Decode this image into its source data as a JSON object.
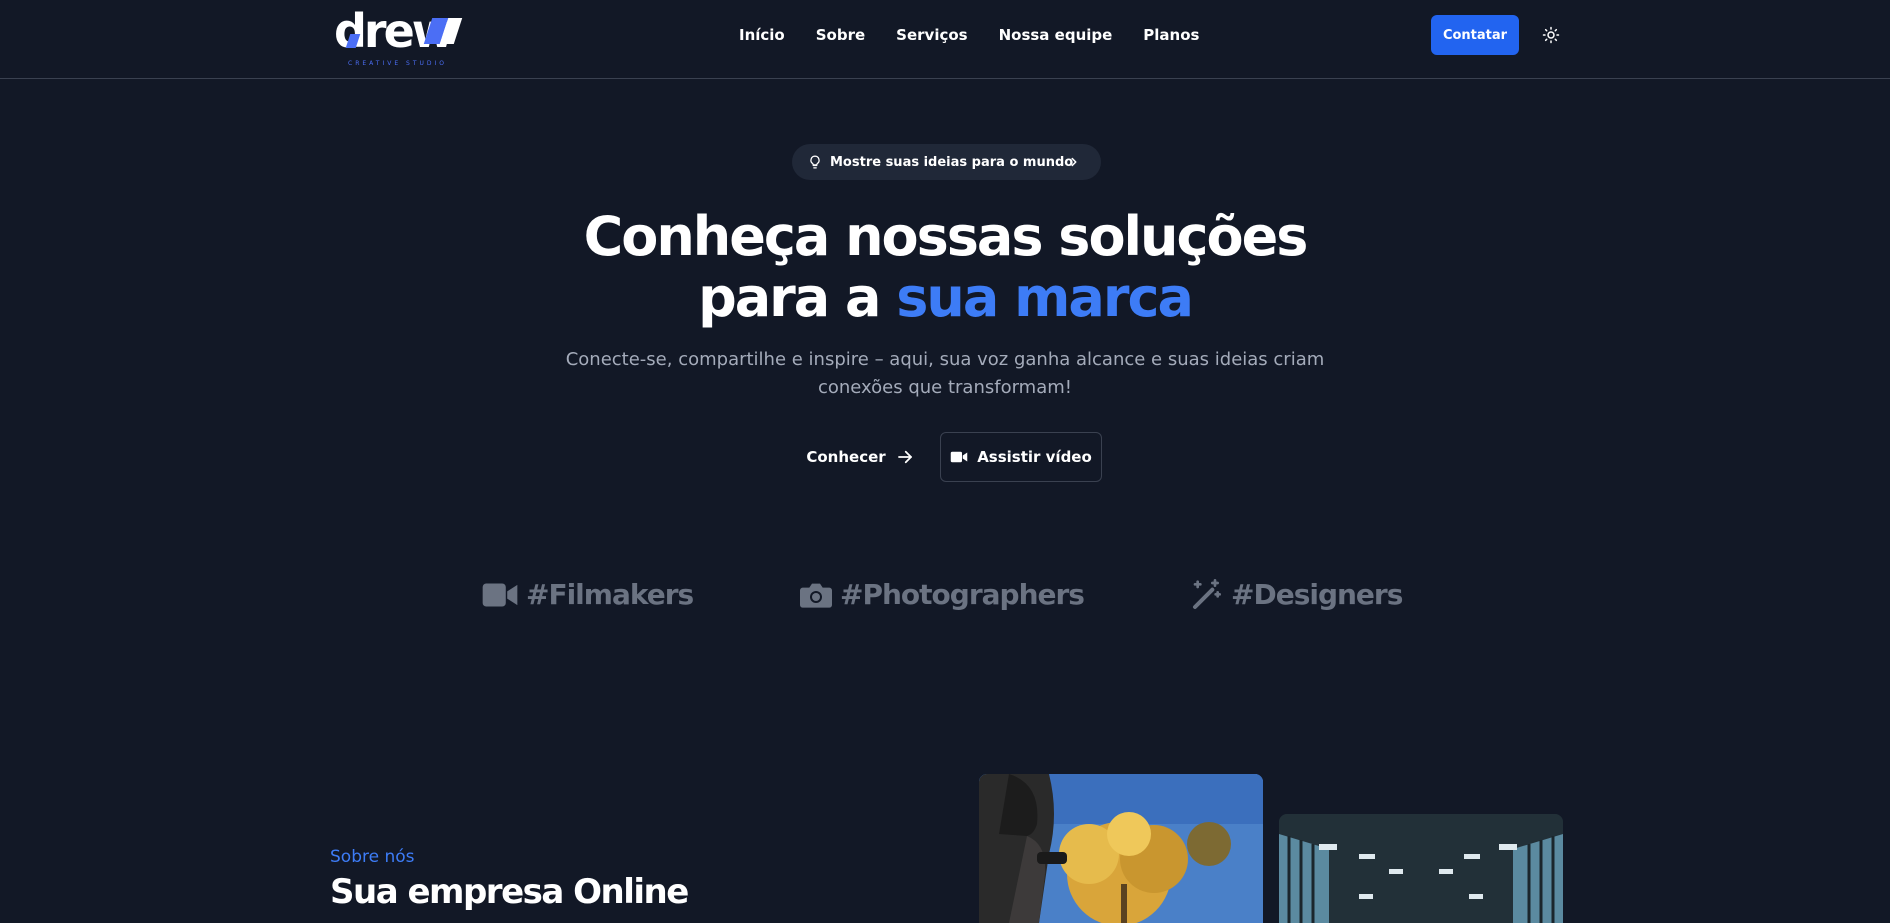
{
  "header": {
    "logo_text": "drew",
    "logo_subtitle": "CREATIVE STUDIO",
    "nav": [
      {
        "label": "Início"
      },
      {
        "label": "Sobre"
      },
      {
        "label": "Serviços"
      },
      {
        "label": "Nossa equipe"
      },
      {
        "label": "Planos"
      }
    ],
    "contact_label": "Contatar",
    "theme_icon": "sun-icon"
  },
  "hero": {
    "pill_text": "Mostre suas ideias para o mundo",
    "title_line1": "Conheça nossas soluções",
    "title_line2_plain": "para a ",
    "title_line2_accent": "sua marca",
    "subtitle": "Conecte-se, compartilhe e inspire – aqui, sua voz ganha alcance e suas ideias criam conexões que transformam!",
    "primary_cta": "Conhecer",
    "secondary_cta": "Assistir vídeo"
  },
  "tags": [
    {
      "label": "#Filmakers",
      "icon": "video-camera-icon"
    },
    {
      "label": "#Photographers",
      "icon": "camera-icon"
    },
    {
      "label": "#Designers",
      "icon": "magic-wand-icon"
    }
  ],
  "about": {
    "label": "Sobre nós",
    "title": "Sua empresa Online"
  },
  "colors": {
    "background": "#121826",
    "accent": "#3d7cf6",
    "button": "#2264f0",
    "muted": "#6b7382"
  }
}
